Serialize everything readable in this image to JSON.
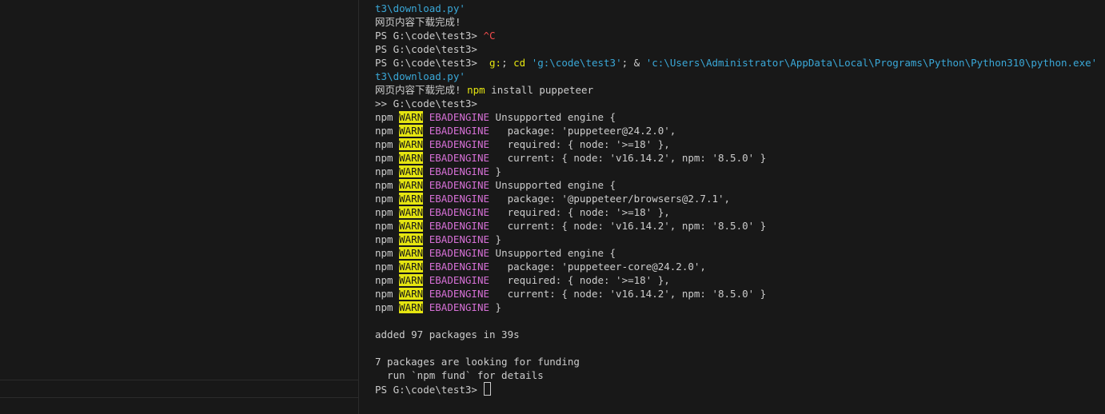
{
  "terminal": {
    "lines": [
      {
        "segments": [
          {
            "text": "t3\\download.py'",
            "color": "cyan"
          }
        ]
      },
      {
        "segments": [
          {
            "text": "网页内容下载完成!",
            "color": "white"
          }
        ]
      },
      {
        "segments": [
          {
            "text": "PS G:\\code\\test3> ",
            "color": "white"
          },
          {
            "text": "^C",
            "color": "red"
          }
        ]
      },
      {
        "segments": [
          {
            "text": "PS G:\\code\\test3>",
            "color": "white"
          }
        ]
      },
      {
        "segments": [
          {
            "text": "PS G:\\code\\test3>  ",
            "color": "white"
          },
          {
            "text": "g:",
            "color": "yellow"
          },
          {
            "text": "; ",
            "color": "white"
          },
          {
            "text": "cd",
            "color": "yellow"
          },
          {
            "text": " ",
            "color": "white"
          },
          {
            "text": "'g:\\code\\test3'",
            "color": "cyan"
          },
          {
            "text": "; & ",
            "color": "white"
          },
          {
            "text": "'c:\\Users\\Administrator\\AppData\\Local\\Programs\\Python\\Python310\\python.exe'",
            "color": "cyan"
          },
          {
            "text": " ",
            "color": "white"
          },
          {
            "text": "'c:\\Users\\",
            "color": "cyan"
          }
        ]
      },
      {
        "segments": [
          {
            "text": "t3\\download.py'",
            "color": "cyan"
          }
        ]
      },
      {
        "segments": [
          {
            "text": "网页内容下载完成! ",
            "color": "white"
          },
          {
            "text": "npm",
            "color": "yellow"
          },
          {
            "text": " install puppeteer",
            "color": "white"
          }
        ]
      },
      {
        "segments": [
          {
            "text": ">> G:\\code\\test3>",
            "color": "white"
          }
        ]
      },
      {
        "segments": [
          {
            "text": "npm ",
            "color": "white"
          },
          {
            "text": "WARN",
            "color": "warn"
          },
          {
            "text": " ",
            "color": "white"
          },
          {
            "text": "EBADENGINE",
            "color": "magenta"
          },
          {
            "text": " Unsupported engine {",
            "color": "white"
          }
        ]
      },
      {
        "segments": [
          {
            "text": "npm ",
            "color": "white"
          },
          {
            "text": "WARN",
            "color": "warn"
          },
          {
            "text": " ",
            "color": "white"
          },
          {
            "text": "EBADENGINE",
            "color": "magenta"
          },
          {
            "text": "   package: 'puppeteer@24.2.0',",
            "color": "white"
          }
        ]
      },
      {
        "segments": [
          {
            "text": "npm ",
            "color": "white"
          },
          {
            "text": "WARN",
            "color": "warn"
          },
          {
            "text": " ",
            "color": "white"
          },
          {
            "text": "EBADENGINE",
            "color": "magenta"
          },
          {
            "text": "   required: { node: '>=18' },",
            "color": "white"
          }
        ]
      },
      {
        "segments": [
          {
            "text": "npm ",
            "color": "white"
          },
          {
            "text": "WARN",
            "color": "warn"
          },
          {
            "text": " ",
            "color": "white"
          },
          {
            "text": "EBADENGINE",
            "color": "magenta"
          },
          {
            "text": "   current: { node: 'v16.14.2', npm: '8.5.0' }",
            "color": "white"
          }
        ]
      },
      {
        "segments": [
          {
            "text": "npm ",
            "color": "white"
          },
          {
            "text": "WARN",
            "color": "warn"
          },
          {
            "text": " ",
            "color": "white"
          },
          {
            "text": "EBADENGINE",
            "color": "magenta"
          },
          {
            "text": " }",
            "color": "white"
          }
        ]
      },
      {
        "segments": [
          {
            "text": "npm ",
            "color": "white"
          },
          {
            "text": "WARN",
            "color": "warn"
          },
          {
            "text": " ",
            "color": "white"
          },
          {
            "text": "EBADENGINE",
            "color": "magenta"
          },
          {
            "text": " Unsupported engine {",
            "color": "white"
          }
        ]
      },
      {
        "segments": [
          {
            "text": "npm ",
            "color": "white"
          },
          {
            "text": "WARN",
            "color": "warn"
          },
          {
            "text": " ",
            "color": "white"
          },
          {
            "text": "EBADENGINE",
            "color": "magenta"
          },
          {
            "text": "   package: '@puppeteer/browsers@2.7.1',",
            "color": "white"
          }
        ]
      },
      {
        "segments": [
          {
            "text": "npm ",
            "color": "white"
          },
          {
            "text": "WARN",
            "color": "warn"
          },
          {
            "text": " ",
            "color": "white"
          },
          {
            "text": "EBADENGINE",
            "color": "magenta"
          },
          {
            "text": "   required: { node: '>=18' },",
            "color": "white"
          }
        ]
      },
      {
        "segments": [
          {
            "text": "npm ",
            "color": "white"
          },
          {
            "text": "WARN",
            "color": "warn"
          },
          {
            "text": " ",
            "color": "white"
          },
          {
            "text": "EBADENGINE",
            "color": "magenta"
          },
          {
            "text": "   current: { node: 'v16.14.2', npm: '8.5.0' }",
            "color": "white"
          }
        ]
      },
      {
        "segments": [
          {
            "text": "npm ",
            "color": "white"
          },
          {
            "text": "WARN",
            "color": "warn"
          },
          {
            "text": " ",
            "color": "white"
          },
          {
            "text": "EBADENGINE",
            "color": "magenta"
          },
          {
            "text": " }",
            "color": "white"
          }
        ]
      },
      {
        "segments": [
          {
            "text": "npm ",
            "color": "white"
          },
          {
            "text": "WARN",
            "color": "warn"
          },
          {
            "text": " ",
            "color": "white"
          },
          {
            "text": "EBADENGINE",
            "color": "magenta"
          },
          {
            "text": " Unsupported engine {",
            "color": "white"
          }
        ]
      },
      {
        "segments": [
          {
            "text": "npm ",
            "color": "white"
          },
          {
            "text": "WARN",
            "color": "warn"
          },
          {
            "text": " ",
            "color": "white"
          },
          {
            "text": "EBADENGINE",
            "color": "magenta"
          },
          {
            "text": "   package: 'puppeteer-core@24.2.0',",
            "color": "white"
          }
        ]
      },
      {
        "segments": [
          {
            "text": "npm ",
            "color": "white"
          },
          {
            "text": "WARN",
            "color": "warn"
          },
          {
            "text": " ",
            "color": "white"
          },
          {
            "text": "EBADENGINE",
            "color": "magenta"
          },
          {
            "text": "   required: { node: '>=18' },",
            "color": "white"
          }
        ]
      },
      {
        "segments": [
          {
            "text": "npm ",
            "color": "white"
          },
          {
            "text": "WARN",
            "color": "warn"
          },
          {
            "text": " ",
            "color": "white"
          },
          {
            "text": "EBADENGINE",
            "color": "magenta"
          },
          {
            "text": "   current: { node: 'v16.14.2', npm: '8.5.0' }",
            "color": "white"
          }
        ]
      },
      {
        "segments": [
          {
            "text": "npm ",
            "color": "white"
          },
          {
            "text": "WARN",
            "color": "warn"
          },
          {
            "text": " ",
            "color": "white"
          },
          {
            "text": "EBADENGINE",
            "color": "magenta"
          },
          {
            "text": " }",
            "color": "white"
          }
        ]
      },
      {
        "segments": []
      },
      {
        "segments": [
          {
            "text": "added 97 packages in 39s",
            "color": "white"
          }
        ]
      },
      {
        "segments": []
      },
      {
        "segments": [
          {
            "text": "7 packages are looking for funding",
            "color": "white"
          }
        ]
      },
      {
        "segments": [
          {
            "text": "  run `npm fund` for details",
            "color": "white"
          }
        ]
      },
      {
        "segments": [
          {
            "text": "PS G:\\code\\test3> ",
            "color": "white"
          }
        ],
        "cursor": true
      }
    ]
  },
  "colors": {
    "background": "#181818",
    "text": "#cccccc",
    "cyan": "#3aa8d8",
    "yellow": "#e5e510",
    "red": "#f14c4c",
    "magenta": "#d670d6"
  }
}
